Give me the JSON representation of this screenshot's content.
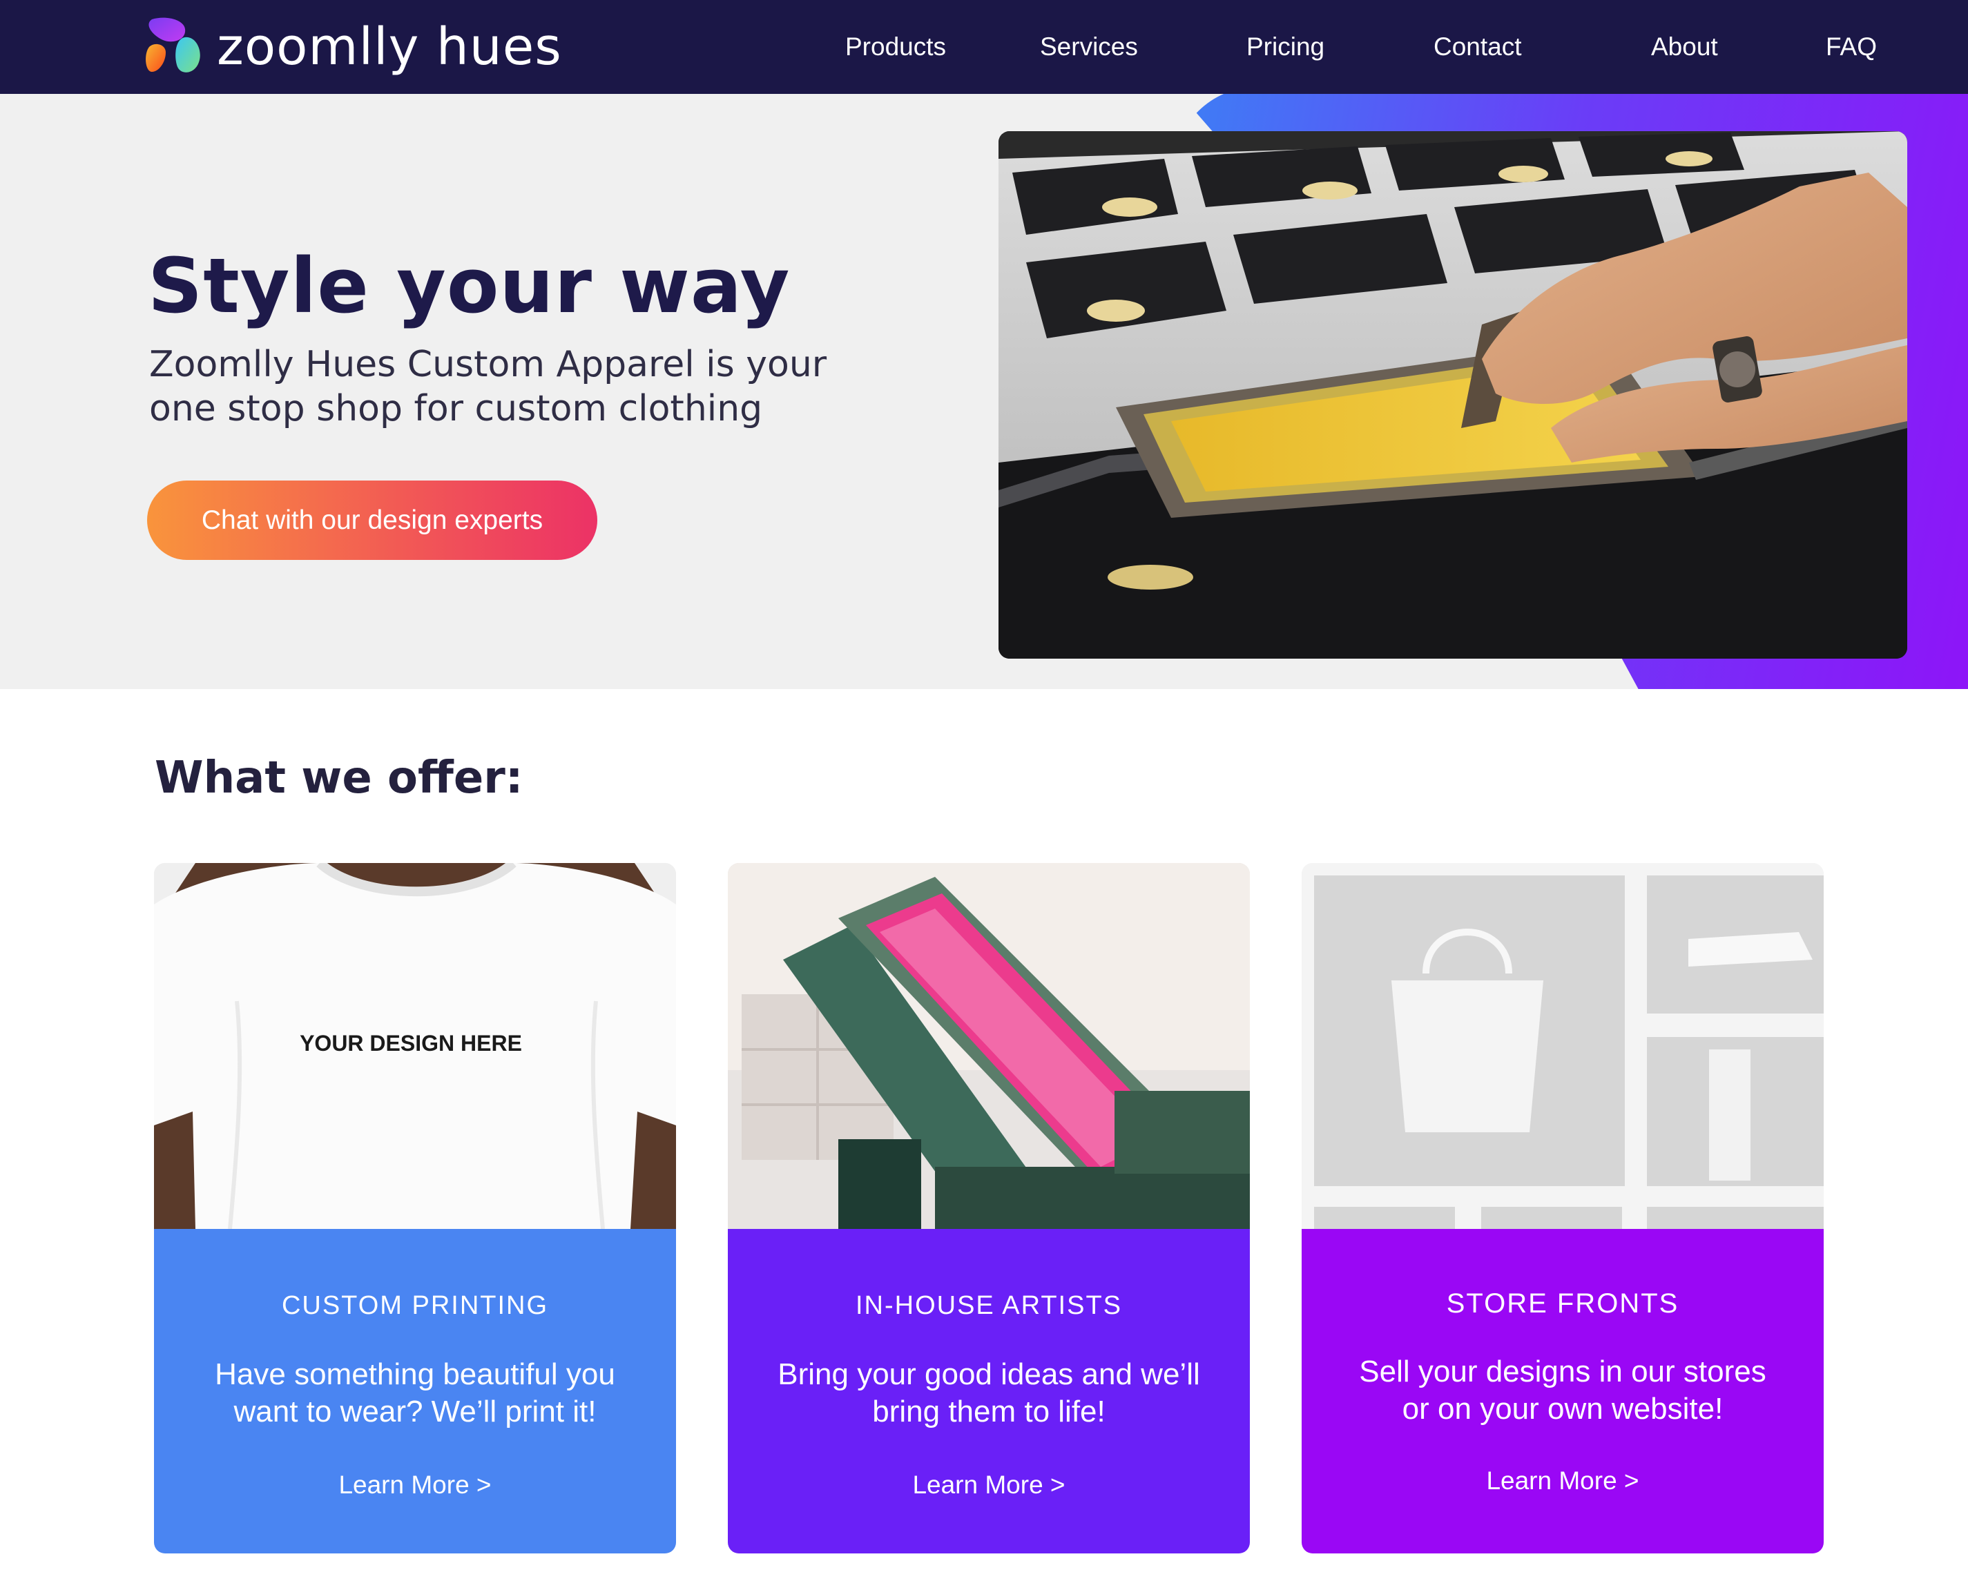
{
  "brand": {
    "name": "zoomlly hues",
    "colors": {
      "navy": "#1b1747",
      "blue": "#4a85f2",
      "indigo": "#6a20f7",
      "purple": "#9a07f5"
    }
  },
  "nav": {
    "items": [
      {
        "label": "Products"
      },
      {
        "label": "Services"
      },
      {
        "label": "Pricing"
      },
      {
        "label": "Contact"
      },
      {
        "label": "About"
      },
      {
        "label": "FAQ"
      }
    ]
  },
  "hero": {
    "title": "Style your way",
    "subtitle": "Zoomlly Hues Custom Apparel is your one stop shop for custom clothing",
    "cta": "Chat with our design experts",
    "image": "screen-printing-photo"
  },
  "offer": {
    "heading": "What we offer:",
    "cards": [
      {
        "title": "CUSTOM PRINTING",
        "description": "Have something beautiful you want to wear? We’ll print it!",
        "link": "Learn More >",
        "image_text": "YOUR DESIGN HERE",
        "color": "#4a85f2"
      },
      {
        "title": "IN-HOUSE ARTISTS",
        "description": "Bring your good ideas and we’ll bring them to life!",
        "link": "Learn More >",
        "color": "#6a20f7"
      },
      {
        "title": "STORE FRONTS",
        "description": "Sell your designs in our stores or on your own website!",
        "link": "Learn More >",
        "color": "#9a07f5"
      }
    ]
  }
}
